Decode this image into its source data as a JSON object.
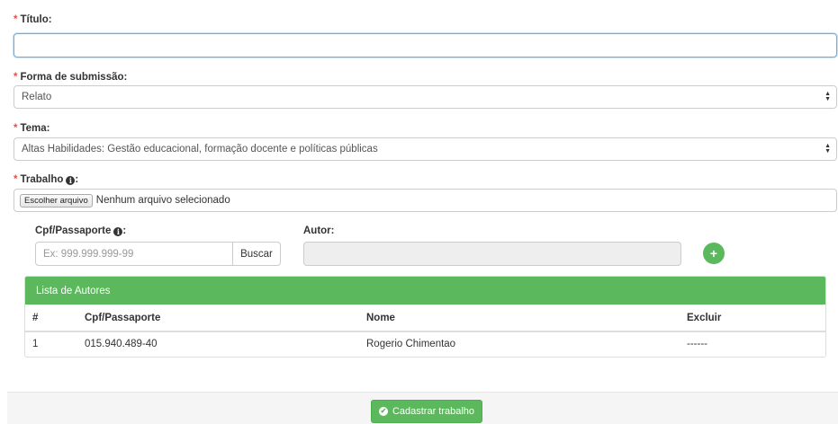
{
  "form": {
    "required_mark": "*",
    "titulo": {
      "label": "Título:",
      "value": ""
    },
    "forma": {
      "label": "Forma de submissão:",
      "selected": "Relato"
    },
    "tema": {
      "label": "Tema:",
      "selected": "Altas Habilidades: Gestão educacional, formação docente e políticas públicas"
    },
    "trabalho": {
      "label": "Trabalho",
      "suffix": ":",
      "file_button": "Escolher arquivo",
      "file_status": "Nenhum arquivo selecionado"
    }
  },
  "author_search": {
    "cpf_label": "Cpf/Passaporte",
    "cpf_suffix": ":",
    "cpf_placeholder": "Ex: 999.999.999-99",
    "buscar_label": "Buscar",
    "autor_label": "Autor:",
    "autor_value": "",
    "add_icon": "+"
  },
  "authors_panel": {
    "title": "Lista de Autores",
    "columns": [
      "#",
      "Cpf/Passaporte",
      "Nome",
      "Excluir"
    ],
    "rows": [
      [
        "1",
        "015.940.489-40",
        "Rogerio Chimentao",
        "------"
      ]
    ]
  },
  "footer": {
    "submit_label": "Cadastrar trabalho",
    "submit_icon": "✔"
  },
  "icons": {
    "info": "info-circle-icon",
    "select": "select-arrows-icon",
    "check": "check-circle-icon",
    "plus": "plus-circle-icon"
  },
  "colors": {
    "accent": "#5cb85c",
    "required": "#d9534f",
    "focus": "#66afe9"
  }
}
